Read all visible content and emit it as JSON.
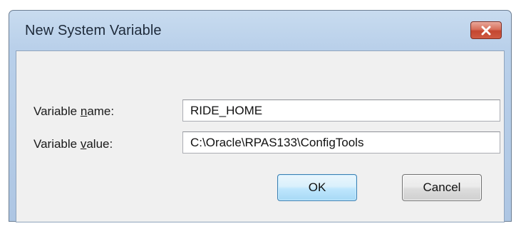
{
  "window": {
    "title": "New System Variable",
    "close_icon": "close-icon"
  },
  "form": {
    "name_label_pre": "Variable ",
    "name_label_accel": "n",
    "name_label_post": "ame:",
    "name_value": "RIDE_HOME",
    "value_label_pre": "Variable ",
    "value_label_accel": "v",
    "value_label_post": "alue:",
    "value_value": "C:\\Oracle\\RPAS133\\ConfigTools"
  },
  "buttons": {
    "ok_label": "OK",
    "cancel_label": "Cancel"
  },
  "colors": {
    "title_bar": "#b9d0ea",
    "close_button": "#c44630",
    "client_area": "#f0f0f0",
    "default_button_border": "#3c7fb1"
  }
}
